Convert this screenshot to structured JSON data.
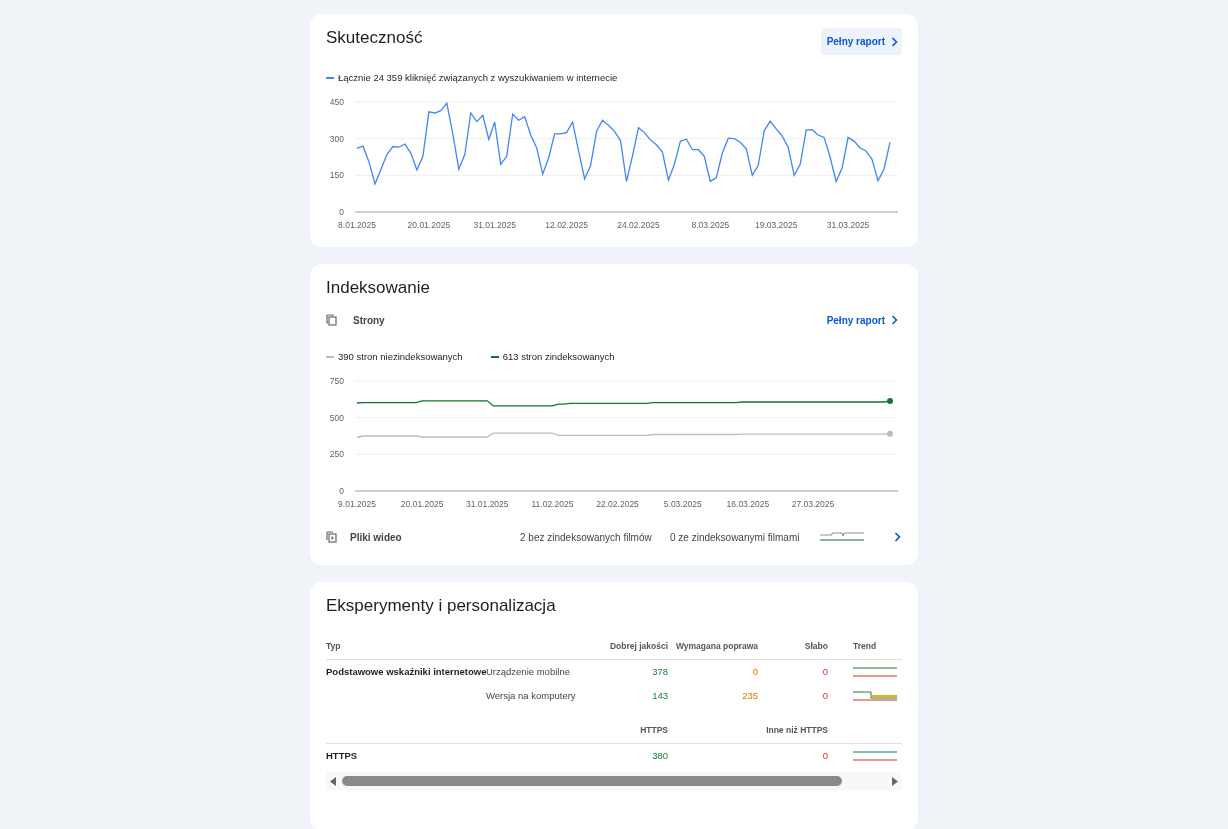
{
  "performance": {
    "title": "Skuteczność",
    "report_link": "Pełny raport",
    "chart_data": {
      "type": "line",
      "ylim": [
        0,
        450
      ],
      "yticks": [
        0,
        150,
        300,
        450
      ],
      "categories": [
        "8.01.2025",
        null,
        null,
        null,
        null,
        null,
        null,
        null,
        null,
        null,
        null,
        null,
        "20.01.2025",
        null,
        null,
        null,
        null,
        null,
        null,
        null,
        null,
        null,
        null,
        "31.01.2025",
        null,
        null,
        null,
        null,
        null,
        null,
        null,
        null,
        null,
        null,
        null,
        "12.02.2025",
        null,
        null,
        null,
        null,
        null,
        null,
        null,
        null,
        null,
        null,
        null,
        "24.02.2025",
        null,
        null,
        null,
        null,
        null,
        null,
        null,
        null,
        null,
        null,
        null,
        "8.03.2025",
        null,
        null,
        null,
        null,
        null,
        null,
        null,
        null,
        null,
        null,
        "19.03.2025",
        null,
        null,
        null,
        null,
        null,
        null,
        null,
        null,
        null,
        null,
        null,
        "31.03.2025",
        null,
        null,
        null,
        null,
        null,
        null,
        null
      ],
      "series": [
        {
          "name": "Łącznie 24 359 kliknięć związanych z wyszukiwaniem w internecie",
          "color": "#4285f4",
          "values": [
            260,
            270,
            205,
            115,
            175,
            235,
            268,
            265,
            278,
            240,
            172,
            228,
            410,
            405,
            415,
            445,
            320,
            175,
            235,
            405,
            370,
            395,
            297,
            368,
            195,
            228,
            400,
            375,
            390,
            315,
            262,
            155,
            220,
            320,
            320,
            325,
            368,
            250,
            135,
            190,
            330,
            375,
            355,
            330,
            292,
            125,
            230,
            345,
            325,
            295,
            275,
            245,
            130,
            195,
            290,
            298,
            255,
            255,
            228,
            125,
            140,
            240,
            302,
            300,
            285,
            258,
            150,
            190,
            332,
            372,
            340,
            310,
            265,
            150,
            195,
            335,
            337,
            315,
            305,
            225,
            125,
            180,
            305,
            290,
            262,
            250,
            215,
            128,
            175,
            285
          ]
        }
      ]
    }
  },
  "indexing": {
    "title": "Indeksowanie",
    "pages": {
      "label": "Strony",
      "report_link": "Pełny raport"
    },
    "chart_data": {
      "type": "line",
      "ylim": [
        0,
        750
      ],
      "yticks": [
        0,
        250,
        500,
        750
      ],
      "categories": [
        "9.01.2025",
        null,
        null,
        null,
        null,
        null,
        null,
        null,
        null,
        null,
        null,
        "20.01.2025",
        null,
        null,
        null,
        null,
        null,
        null,
        null,
        null,
        null,
        null,
        "31.01.2025",
        null,
        null,
        null,
        null,
        null,
        null,
        null,
        null,
        null,
        null,
        "11.02.2025",
        null,
        null,
        null,
        null,
        null,
        null,
        null,
        null,
        null,
        null,
        "22.02.2025",
        null,
        null,
        null,
        null,
        null,
        null,
        null,
        null,
        null,
        null,
        "5.03.2025",
        null,
        null,
        null,
        null,
        null,
        null,
        null,
        null,
        null,
        null,
        "16.03.2025",
        null,
        null,
        null,
        null,
        null,
        null,
        null,
        null,
        null,
        null,
        "27.03.2025",
        null,
        null,
        null,
        null,
        null,
        null,
        null,
        null,
        null,
        null,
        null,
        null,
        null
      ],
      "series": [
        {
          "name": "390 stron niezindeksowanych",
          "color": "#bdbdbd",
          "values": [
            365,
            375,
            375,
            375,
            375,
            375,
            375,
            375,
            375,
            375,
            375,
            368,
            368,
            368,
            368,
            368,
            368,
            368,
            368,
            368,
            368,
            368,
            368,
            395,
            395,
            395,
            395,
            395,
            395,
            395,
            395,
            395,
            395,
            395,
            380,
            380,
            380,
            380,
            380,
            380,
            380,
            380,
            380,
            380,
            380,
            380,
            380,
            380,
            380,
            380,
            385,
            385,
            385,
            385,
            385,
            385,
            385,
            385,
            385,
            385,
            385,
            385,
            385,
            385,
            385,
            388,
            388,
            388,
            388,
            388,
            388,
            388,
            388,
            388,
            388,
            388,
            388,
            388,
            388,
            388,
            388,
            388,
            388,
            388,
            388,
            388,
            388,
            388,
            388,
            388,
            390
          ]
        },
        {
          "name": "613 stron zindeksowanych",
          "color": "#137333",
          "values": [
            600,
            603,
            603,
            603,
            603,
            603,
            603,
            603,
            603,
            603,
            603,
            615,
            615,
            615,
            615,
            615,
            615,
            615,
            615,
            615,
            615,
            615,
            615,
            580,
            580,
            580,
            580,
            580,
            580,
            580,
            580,
            580,
            580,
            580,
            592,
            592,
            597,
            597,
            597,
            597,
            597,
            597,
            597,
            597,
            597,
            597,
            597,
            597,
            597,
            597,
            602,
            602,
            602,
            602,
            602,
            602,
            602,
            602,
            602,
            602,
            602,
            602,
            602,
            602,
            602,
            607,
            607,
            607,
            607,
            607,
            607,
            607,
            607,
            607,
            607,
            607,
            607,
            607,
            607,
            607,
            607,
            607,
            607,
            607,
            607,
            607,
            607,
            607,
            607,
            607,
            613
          ]
        }
      ]
    },
    "video": {
      "label": "Pliki wideo",
      "not_indexed": "2 bez zindeksowanych filmów",
      "indexed": "0 ze zindeksowanymi filmami"
    }
  },
  "experience": {
    "title": "Eksperymenty i personalizacja",
    "columns": [
      "Typ",
      "Dobrej jakości",
      "Wymagana poprawa",
      "Słabo",
      "Trend"
    ],
    "groups": [
      {
        "name": "Podstawowe wskaźniki internetowe",
        "rows": [
          {
            "device": "Urządzenie mobilne",
            "good": "378",
            "needs_improvement": "0",
            "poor": "0"
          },
          {
            "device": "Wersja na komputery",
            "good": "143",
            "needs_improvement": "235",
            "poor": "0"
          }
        ]
      }
    ],
    "https": {
      "columns": [
        "HTTPS",
        "Inne niż HTTPS"
      ],
      "rows": [
        {
          "name": "HTTPS",
          "https": "380",
          "non_https": "0"
        }
      ]
    }
  }
}
